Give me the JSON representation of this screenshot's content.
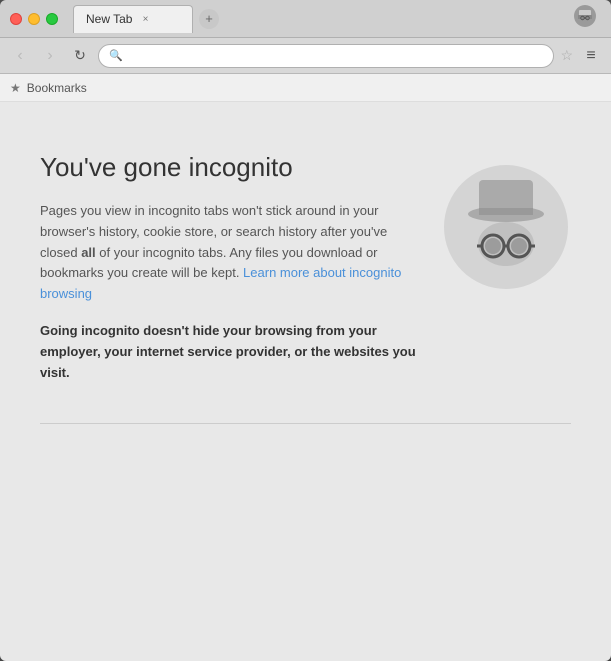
{
  "window": {
    "title": "New Tab"
  },
  "titlebar": {
    "tab_label": "New Tab",
    "tab_close": "×"
  },
  "toolbar": {
    "back_label": "‹",
    "forward_label": "›",
    "refresh_label": "↻",
    "omnibox_value": "",
    "omnibox_placeholder": "",
    "star_label": "☆",
    "menu_label": "≡"
  },
  "bookmarks_bar": {
    "star_icon": "★",
    "label": "Bookmarks"
  },
  "incognito": {
    "title": "You've gone incognito",
    "body_text": "Pages you view in incognito tabs won't stick around in your browser's history, cookie store, or search history after you've closed ",
    "body_all": "all",
    "body_text2": " of your incognito tabs. Any files you download or bookmarks you create will be kept. ",
    "link_text": "Learn more about incognito browsing",
    "warning": "Going incognito doesn't hide your browsing from your employer, your internet service provider, or the websites you visit."
  }
}
